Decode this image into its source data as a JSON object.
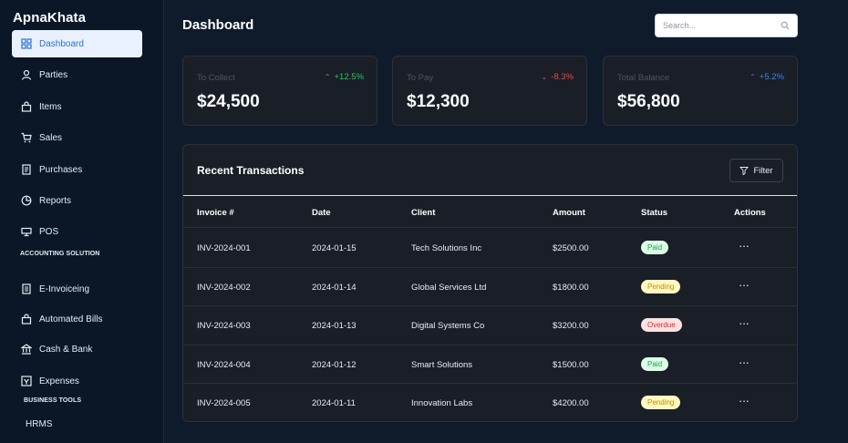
{
  "sidebar": {
    "brand": "ApnaKhata",
    "items": [
      {
        "label": "Dashboard",
        "icon": "dashboard-icon"
      },
      {
        "label": "Parties",
        "icon": "user-icon"
      },
      {
        "label": "Items",
        "icon": "bag-icon"
      },
      {
        "label": "Sales",
        "icon": "cart-icon"
      },
      {
        "label": "Purchases",
        "icon": "receipt-icon"
      },
      {
        "label": "Reports",
        "icon": "pie-chart-icon"
      },
      {
        "label": "POS",
        "icon": "monitor-icon"
      }
    ],
    "section_accounting": "ACCOUNTING SOLUTION",
    "accounting_items": [
      {
        "label": "E-Invoiceing",
        "icon": "invoice-icon"
      },
      {
        "label": "Automated Bills",
        "icon": "lock-bag-icon"
      },
      {
        "label": "Cash & Bank",
        "icon": "bank-icon"
      },
      {
        "label": "Expenses",
        "icon": "expense-icon"
      }
    ],
    "section_business": "BUSINESS TOOLS",
    "business_items": [
      {
        "label": "HRMS"
      }
    ]
  },
  "header": {
    "title": "Dashboard",
    "search_placeholder": "Search..."
  },
  "stats": [
    {
      "label": "To Collect",
      "value": "$24,500",
      "trend": "+12.5%",
      "trend_color": "#22c55e",
      "direction": "up"
    },
    {
      "label": "To Pay",
      "value": "$12,300",
      "trend": "-8.3%",
      "trend_color": "#ef4444",
      "direction": "down"
    },
    {
      "label": "Total Balance",
      "value": "$56,800",
      "trend": "+5.2%",
      "trend_color": "#3b82f6",
      "direction": "up"
    }
  ],
  "transactions": {
    "title": "Recent Transactions",
    "filter_label": "Filter",
    "columns": [
      "Invoice #",
      "Date",
      "Client",
      "Amount",
      "Status",
      "Actions"
    ],
    "rows": [
      {
        "invoice": "INV-2024-001",
        "date": "2024-01-15",
        "client": "Tech Solutions Inc",
        "amount": "$2500.00",
        "status": "Paid",
        "actions": "···"
      },
      {
        "invoice": "INV-2024-002",
        "date": "2024-01-14",
        "client": "Global Services Ltd",
        "amount": "$1800.00",
        "status": "Pending",
        "actions": "···"
      },
      {
        "invoice": "INV-2024-003",
        "date": "2024-01-13",
        "client": "Digital Systems Co",
        "amount": "$3200.00",
        "status": "Overdue",
        "actions": "···"
      },
      {
        "invoice": "INV-2024-004",
        "date": "2024-01-12",
        "client": "Smart Solutions",
        "amount": "$1500.00",
        "status": "Paid",
        "actions": "···"
      },
      {
        "invoice": "INV-2024-005",
        "date": "2024-01-11",
        "client": "Innovation Labs",
        "amount": "$4200.00",
        "status": "Pending",
        "actions": "···"
      }
    ],
    "status_colors": {
      "Paid": {
        "bg": "#dcfce7",
        "fg": "#16a34a"
      },
      "Pending": {
        "bg": "#fef9c3",
        "fg": "#ca8a04"
      },
      "Overdue": {
        "bg": "#fee2e2",
        "fg": "#dc2626"
      }
    }
  }
}
